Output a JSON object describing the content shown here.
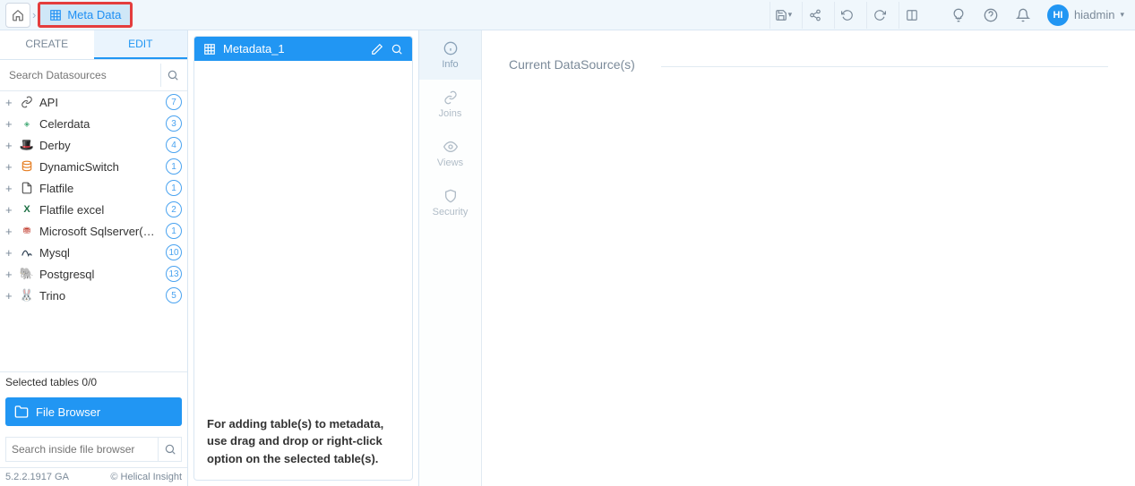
{
  "topbar": {
    "metadata_tab_label": "Meta Data",
    "user_initials": "HI",
    "user_name": "hiadmin"
  },
  "sidebar": {
    "tabs": {
      "create": "CREATE",
      "edit": "EDIT"
    },
    "search_placeholder": "Search Datasources",
    "datasources": [
      {
        "label": "API",
        "count": "7"
      },
      {
        "label": "Celerdata",
        "count": "3"
      },
      {
        "label": "Derby",
        "count": "4"
      },
      {
        "label": "DynamicSwitch",
        "count": "1"
      },
      {
        "label": "Flatfile",
        "count": "1"
      },
      {
        "label": "Flatfile excel",
        "count": "2"
      },
      {
        "label": "Microsoft Sqlserver(so..",
        "count": "1"
      },
      {
        "label": "Mysql",
        "count": "10"
      },
      {
        "label": "Postgresql",
        "count": "13"
      },
      {
        "label": "Trino",
        "count": "5"
      }
    ],
    "selected_text": "Selected tables 0/0",
    "file_browser_label": "File Browser",
    "fb_search_placeholder": "Search inside file browser",
    "version": "5.2.2.1917 GA",
    "copyright": "© Helical Insight"
  },
  "metadata_panel": {
    "title": "Metadata_1",
    "hint": "For adding table(s) to metadata, use drag and drop or right-click option on the selected table(s)."
  },
  "strip": {
    "info": "Info",
    "joins": "Joins",
    "views": "Views",
    "security": "Security"
  },
  "content": {
    "current_ds_label": "Current DataSource(s)"
  }
}
